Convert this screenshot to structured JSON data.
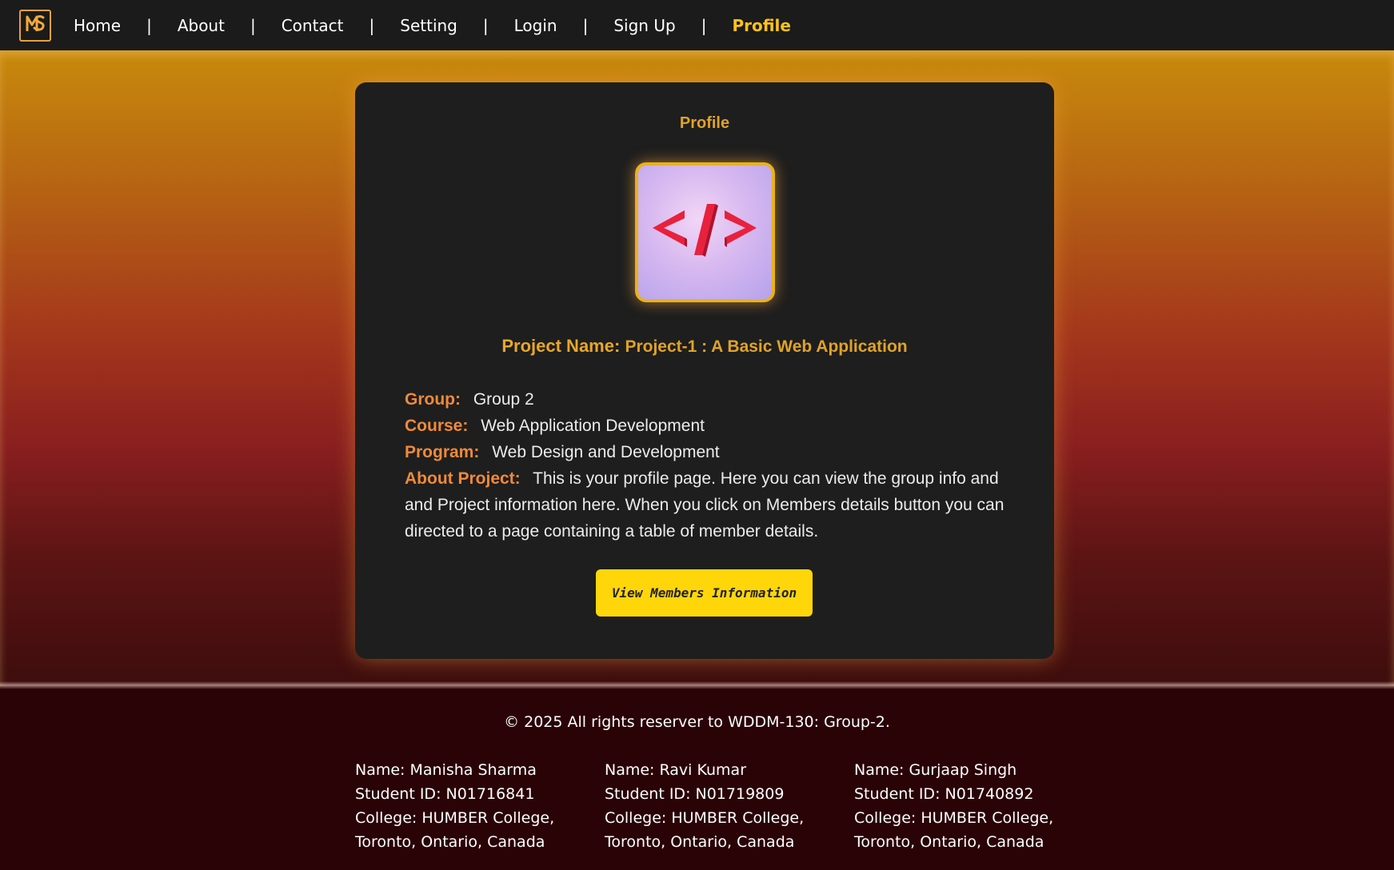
{
  "nav": {
    "logo_icon": "ms-monogram-logo",
    "items": [
      {
        "label": "Home"
      },
      {
        "label": "About"
      },
      {
        "label": "Contact"
      },
      {
        "label": "Setting"
      },
      {
        "label": "Login"
      },
      {
        "label": "Sign Up"
      },
      {
        "label": "Profile",
        "active": true
      }
    ],
    "separator": "|"
  },
  "card": {
    "title": "Profile",
    "avatar_icon": "code-tag-icon",
    "project_label": "Project Name:",
    "project_value": "Project-1 : A Basic Web Application",
    "group_label": "Group:",
    "group_value": "Group 2",
    "course_label": "Course:",
    "course_value": "Web Application Development",
    "program_label": "Program:",
    "program_value": "Web Design and Development",
    "about_label": "About Project:",
    "about_value": "This is your profile page. Here you can view the group info and and Project information here. When you click on Members details button you can directed to a page containing a table of member details.",
    "button_label": "View Members Information"
  },
  "footer": {
    "copyright": "© 2025 All rights reserver to WDDM-130: Group-2.",
    "members": [
      {
        "name": "Name: Manisha Sharma",
        "id": "Student ID: N01716841",
        "college": "College: HUMBER College,",
        "location": "Toronto, Ontario, Canada"
      },
      {
        "name": "Name: Ravi Kumar",
        "id": "Student ID: N01719809",
        "college": "College: HUMBER College,",
        "location": "Toronto, Ontario, Canada"
      },
      {
        "name": "Name: Gurjaap Singh",
        "id": "Student ID: N01740892",
        "college": "College: HUMBER College,",
        "location": "Toronto, Ontario, Canada"
      }
    ]
  },
  "colors": {
    "accent": "#e0a327",
    "key_label": "#ef8a3a",
    "button": "#ffd60a",
    "nav_active": "#ffc21a"
  }
}
